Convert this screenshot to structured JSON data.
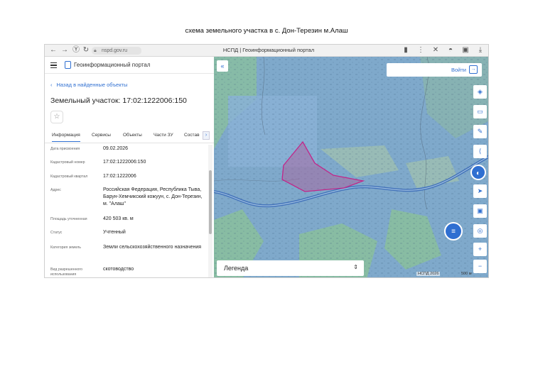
{
  "document": {
    "caption": "схема земельного участка в с. Дон-Терезин м.Алаш"
  },
  "browser": {
    "url": "nspd.gov.ru",
    "tab_title": "НСПД | Геоинформационный портал"
  },
  "panel": {
    "brand": "Геоинформационный портал",
    "back_link": "Назад в найденные объекты",
    "parcel_title": "Земельный участок: 17:02:1222006:150",
    "tabs": [
      {
        "label": "Информация",
        "active": true
      },
      {
        "label": "Сервисы"
      },
      {
        "label": "Объекты"
      },
      {
        "label": "Части ЗУ"
      },
      {
        "label": "Состав"
      }
    ],
    "rows": [
      {
        "key": "Дата присвоения",
        "value": "09.02.2026"
      },
      {
        "key": "Кадастровый номер",
        "value": "17:02:1222006:150"
      },
      {
        "key": "Кадастровый квартал",
        "value": "17:02:1222006"
      },
      {
        "key": "Адрес",
        "value": "Российская Федерация, Республика Тыва, Барун-Хемчикский кожуун, с. Дон-Терезин, м. \"Алаш\""
      },
      {
        "key": "Площадь уточненная",
        "value": "420 503 кв. м"
      },
      {
        "key": "Статус",
        "value": "Учтенный"
      },
      {
        "key": "Категория земель",
        "value": "Земли сельскохозяйственного назначения"
      },
      {
        "key": "Вид разрешенного использования",
        "value": "скотоводство"
      }
    ]
  },
  "map": {
    "login_label": "Войти",
    "legend_label": "Легенда",
    "attribution": "НСПД 2026",
    "scale_label": "500 м",
    "colors": {
      "water": "#7aa6c9",
      "river": "#3f6fb8",
      "parcel": "#c2268a",
      "green": "#8fc2a3"
    }
  }
}
